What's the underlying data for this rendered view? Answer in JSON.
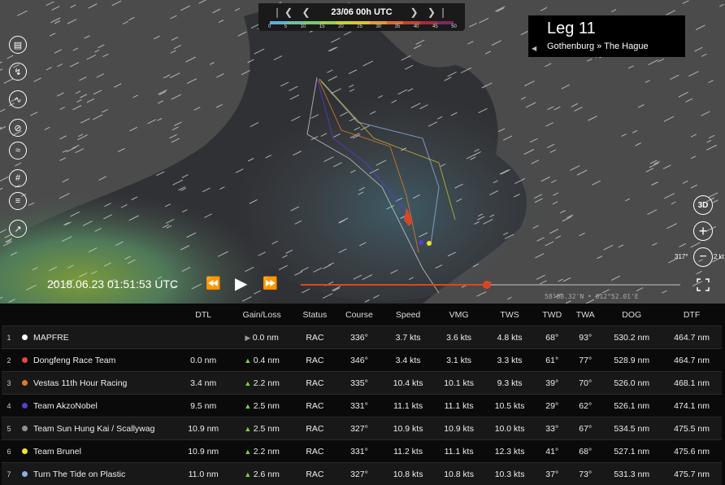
{
  "timebar": {
    "date": "23/06 00h UTC",
    "nav_left": "❘❮ ❮",
    "nav_right": "❯ ❯❘",
    "scale_labels": [
      "0",
      "5",
      "10",
      "15",
      "20",
      "25",
      "30",
      "35",
      "40",
      "45",
      "50"
    ],
    "scale_colors": [
      "#5ab3d8",
      "#6cc0a0",
      "#7cc86e",
      "#9ccd4e",
      "#c6cf3e",
      "#e0be3a",
      "#e59a34",
      "#e06a2e",
      "#c8402c",
      "#a82a3a",
      "#7a2a5a"
    ]
  },
  "leg": {
    "title": "Leg 11",
    "route": "Gothenburg » The Hague",
    "back": "◀"
  },
  "tools": [
    "map-book-icon",
    "route-icon",
    "wind-icon",
    "no-wind-icon",
    "current-icon",
    "grid-icon",
    "layers-icon",
    "chart-icon"
  ],
  "right_controls": {
    "view3d": "3D",
    "zoom_in": "+",
    "zoom_out": "−",
    "compass": "317°",
    "speed_unit": "2 kt"
  },
  "playback": {
    "timestamp": "2018.06.23 01:51:53 UTC",
    "rewind": "⏪",
    "play": "▶",
    "forward": "⏩",
    "progress": 0.49,
    "coords": "58°08.32'N • 012°52.01'E"
  },
  "table": {
    "headers": [
      "",
      "",
      "",
      "DTL",
      "Gain/Loss",
      "Status",
      "Course",
      "Speed",
      "VMG",
      "TWS",
      "TWD",
      "TWA",
      "DOG",
      "DTF"
    ],
    "rows": [
      {
        "idx": "1",
        "color": "#ffffff",
        "name": "MAPFRE",
        "dtl": "",
        "gain_dir": "right",
        "gain": "0.0 nm",
        "status": "RAC",
        "course": "336°",
        "speed": "3.7 kts",
        "vmg": "3.6 kts",
        "tws": "4.8 kts",
        "twd": "68°",
        "twa": "93°",
        "dog": "530.2 nm",
        "dtf": "464.7 nm"
      },
      {
        "idx": "2",
        "color": "#e04a3a",
        "name": "Dongfeng Race Team",
        "dtl": "0.0 nm",
        "gain_dir": "up",
        "gain": "0.4 nm",
        "status": "RAC",
        "course": "346°",
        "speed": "3.4 kts",
        "vmg": "3.1 kts",
        "tws": "3.3 kts",
        "twd": "61°",
        "twa": "77°",
        "dog": "528.9 nm",
        "dtf": "464.7 nm"
      },
      {
        "idx": "3",
        "color": "#e07a30",
        "name": "Vestas 11th Hour Racing",
        "dtl": "3.4 nm",
        "gain_dir": "up",
        "gain": "2.2 nm",
        "status": "RAC",
        "course": "335°",
        "speed": "10.4 kts",
        "vmg": "10.1 kts",
        "tws": "9.3 kts",
        "twd": "39°",
        "twa": "70°",
        "dog": "526.0 nm",
        "dtf": "468.1 nm"
      },
      {
        "idx": "4",
        "color": "#5a3ad8",
        "name": "Team AkzoNobel",
        "dtl": "9.5 nm",
        "gain_dir": "up",
        "gain": "2.5 nm",
        "status": "RAC",
        "course": "331°",
        "speed": "11.1 kts",
        "vmg": "11.1 kts",
        "tws": "10.5 kts",
        "twd": "29°",
        "twa": "62°",
        "dog": "526.1 nm",
        "dtf": "474.1 nm"
      },
      {
        "idx": "5",
        "color": "#909090",
        "name": "Team Sun Hung Kai / Scallywag",
        "dtl": "10.9 nm",
        "gain_dir": "up",
        "gain": "2.5 nm",
        "status": "RAC",
        "course": "327°",
        "speed": "10.9 kts",
        "vmg": "10.9 kts",
        "tws": "10.0 kts",
        "twd": "33°",
        "twa": "67°",
        "dog": "534.5 nm",
        "dtf": "475.5 nm"
      },
      {
        "idx": "6",
        "color": "#f2e32a",
        "name": "Team Brunel",
        "dtl": "10.9 nm",
        "gain_dir": "up",
        "gain": "2.2 nm",
        "status": "RAC",
        "course": "331°",
        "speed": "11.2 kts",
        "vmg": "11.1 kts",
        "tws": "12.3 kts",
        "twd": "41°",
        "twa": "68°",
        "dog": "527.1 nm",
        "dtf": "475.6 nm"
      },
      {
        "idx": "7",
        "color": "#8fb0e0",
        "name": "Turn The Tide on Plastic",
        "dtl": "11.0 nm",
        "gain_dir": "up",
        "gain": "2.6 nm",
        "status": "RAC",
        "course": "327°",
        "speed": "10.8 kts",
        "vmg": "10.8 kts",
        "tws": "10.3 kts",
        "twd": "37°",
        "twa": "73°",
        "dog": "531.3 nm",
        "dtf": "475.7 nm"
      }
    ]
  }
}
